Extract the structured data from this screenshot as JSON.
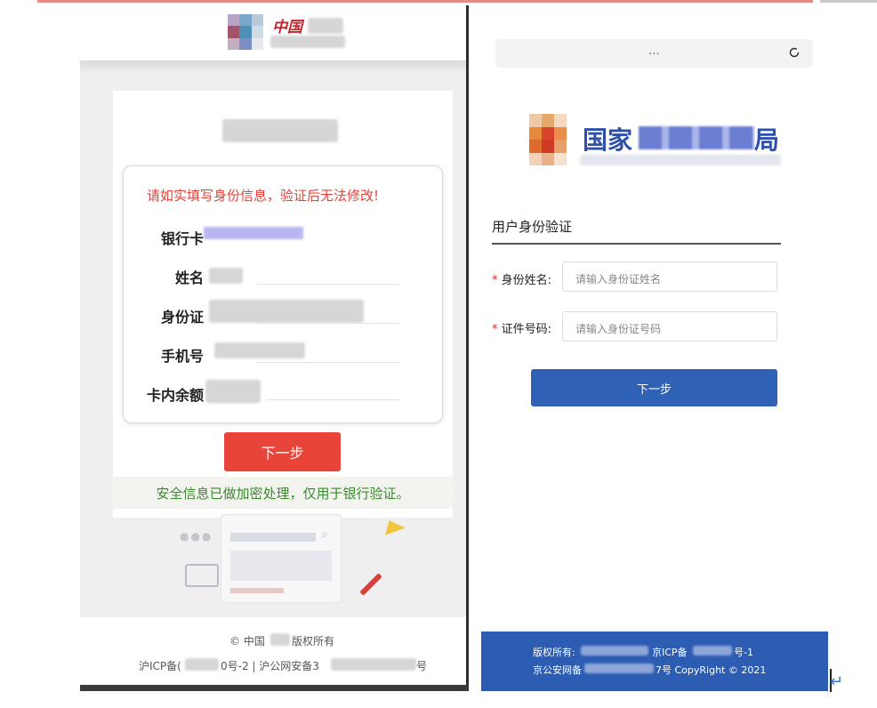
{
  "left": {
    "header_brand": "中国",
    "warning": "请如实填写身份信息，验证后无法修改!",
    "fields": [
      {
        "label": "银行卡"
      },
      {
        "label": "姓名"
      },
      {
        "label": "身份证"
      },
      {
        "label": "手机号"
      },
      {
        "label": "卡内余额"
      }
    ],
    "next_button": "下一步",
    "security_note": "安全信息已做加密处理，仅用于银行验证。",
    "footer_line1": "© 中国",
    "footer_line1_tail": "版权所有",
    "footer_line2_a": "沪ICP备(",
    "footer_line2_b": "0号-2 | 沪公网安备3",
    "footer_line2_c": "号"
  },
  "right": {
    "address_text": "...",
    "gov_prefix": "国家",
    "gov_suffix": "局",
    "section_title": "用户身份验证",
    "fields": [
      {
        "label": "身份姓名:",
        "placeholder": "请输入身份证姓名"
      },
      {
        "label": "证件号码:",
        "placeholder": "请输入身份证号码"
      }
    ],
    "required_mark": "*",
    "next_button": "下一步",
    "footer_line1_a": "版权所有:",
    "footer_line1_b": "京ICP备",
    "footer_line1_c": "号-1",
    "footer_line2_a": "京公安网备",
    "footer_line2_b": "7号 CopyRight © 2021"
  },
  "colors": {
    "red_button": "#e8443a",
    "blue_button": "#2f62b5",
    "gov_blue": "#2d50a8",
    "warning_red": "#e2433a",
    "safe_green": "#3a8a2d"
  },
  "icons": [
    "refresh-icon",
    "search-icon",
    "pencil-icon",
    "paper-plane-icon",
    "return-arrow-icon"
  ]
}
